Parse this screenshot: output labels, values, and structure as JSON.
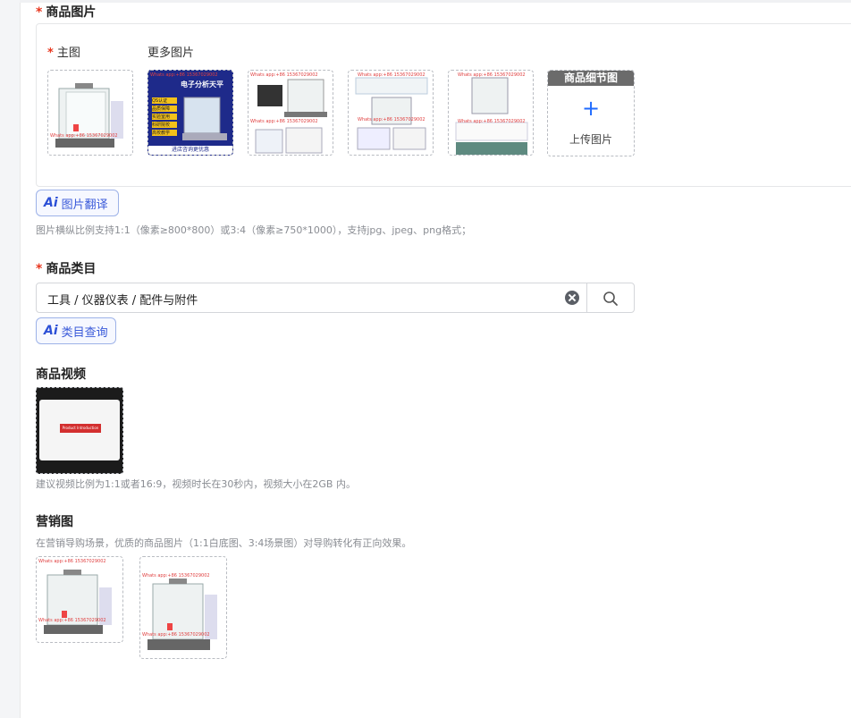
{
  "images_section": {
    "title": "商品图片",
    "main_label": "主图",
    "more_label": "更多图片",
    "watermark": "Whats app:+86 15367029002",
    "detail_header": "商品细节图",
    "upload_text": "上传图片",
    "ai_translate": "图片翻译",
    "hint": "图片横纵比例支持1:1（像素≥800*800）或3:4（像素≥750*1000），支持jpg、jpeg、png格式；"
  },
  "thumb2": {
    "title": "电子分析天平",
    "tags": [
      "QS认证",
      "品质保障",
      "实验室用",
      "科研院校",
      "高校教学"
    ],
    "footer": "进店咨询更优惠"
  },
  "category": {
    "title": "商品类目",
    "value": "工具 / 仪器仪表 / 配件与附件",
    "ai_query": "类目查询"
  },
  "video": {
    "title": "商品视频",
    "overlay": "Product Introduction",
    "hint": "建议视频比例为1:1或者16:9，视频时长在30秒内，视频大小在2GB 内。"
  },
  "marketing": {
    "title": "营销图",
    "hint": "在营销导购场景，优质的商品图片（1:1白底图、3:4场景图）对导购转化有正向效果。"
  },
  "colors": {
    "accent": "#1f6bff",
    "required": "#e8361e",
    "ai": "#3a5ad9"
  },
  "icons": [
    "plus-icon",
    "clear-icon",
    "search-icon",
    "ai-icon"
  ]
}
